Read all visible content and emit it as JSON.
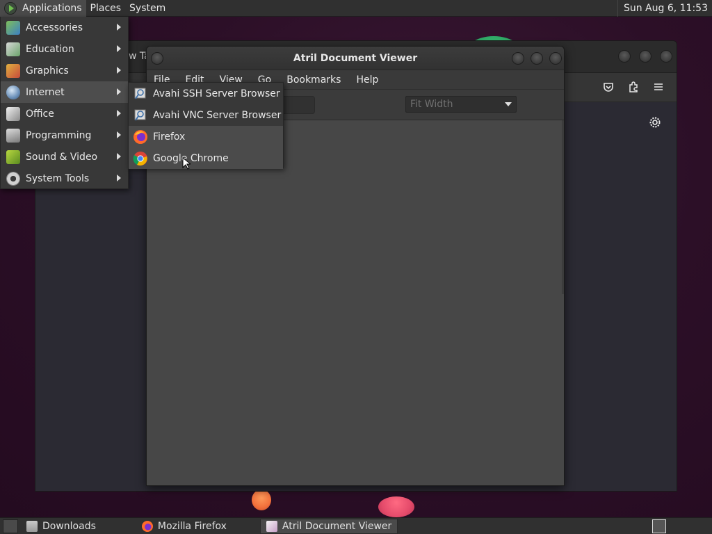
{
  "top_panel": {
    "menus": [
      "Applications",
      "Places",
      "System"
    ],
    "clock": "Sun Aug  6, 11:53"
  },
  "applications_menu": {
    "items": [
      {
        "label": "Accessories",
        "icon": "accessories-icon"
      },
      {
        "label": "Education",
        "icon": "education-icon"
      },
      {
        "label": "Graphics",
        "icon": "graphics-icon"
      },
      {
        "label": "Internet",
        "icon": "internet-globe-icon"
      },
      {
        "label": "Office",
        "icon": "office-icon"
      },
      {
        "label": "Programming",
        "icon": "programming-icon"
      },
      {
        "label": "Sound & Video",
        "icon": "sound-video-icon"
      },
      {
        "label": "System Tools",
        "icon": "gear-icon"
      }
    ],
    "active": "Internet"
  },
  "internet_submenu": {
    "items": [
      {
        "label": "Avahi SSH Server Browser",
        "icon": "avahi-icon"
      },
      {
        "label": "Avahi VNC Server Browser",
        "icon": "avahi-icon"
      },
      {
        "label": "Firefox",
        "icon": "firefox-icon"
      },
      {
        "label": "Google Chrome",
        "icon": "chrome-icon"
      }
    ],
    "hovered": "Google Chrome"
  },
  "atril": {
    "title": "Atril Document Viewer",
    "menu": [
      "File",
      "Edit",
      "View",
      "Go",
      "Bookmarks",
      "Help"
    ],
    "zoom": "Fit Width"
  },
  "firefox_window": {
    "tab_partial": "w Ta"
  },
  "bottom_panel": {
    "tasks": [
      {
        "label": "Downloads",
        "icon": "folder-icon"
      },
      {
        "label": "Mozilla Firefox",
        "icon": "firefox-icon"
      },
      {
        "label": "Atril Document Viewer",
        "icon": "atril-icon"
      }
    ],
    "active_task": "Atril Document Viewer"
  },
  "colors": {
    "panel": "#303030",
    "menu_bg": "#383838",
    "menu_active": "#4d4d4d",
    "desktop": "#2c0f27"
  }
}
